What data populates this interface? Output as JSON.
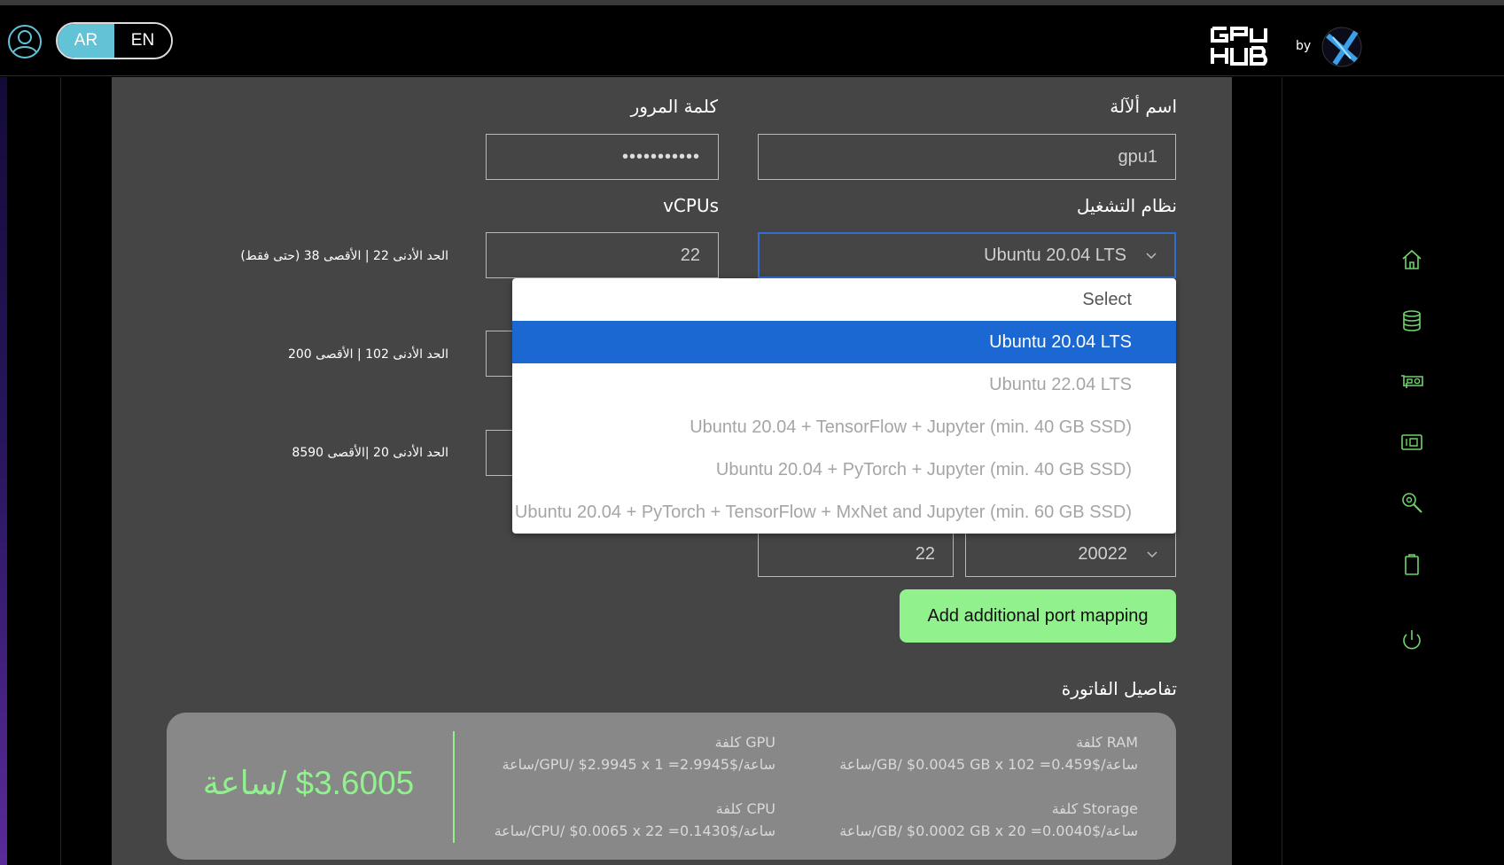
{
  "header": {
    "lang_ar": "AR",
    "lang_en": "EN"
  },
  "form": {
    "machine_name_label": "اسم ألآلة",
    "machine_name_value": "gpu1",
    "password_label": "كلمة المرور",
    "password_value": "•••••••••••",
    "os_label": "نظام التشغيل",
    "os_value": "Ubuntu 20.04 LTS",
    "vcpus_label": "vCPUs",
    "vcpus_value": "22",
    "vcpus_hint": "الحد الأدنى 22 | الأقصى 38 (حتى فقط)",
    "ram_hint": "الحد الأدنى 102 | الأقصى 200",
    "storage_hint": "الحد الأدنى 20 |الأقصى 8590",
    "port_external_value": "20022",
    "port_internal_value": "22",
    "add_port_button": "Add additional port mapping"
  },
  "os_dropdown": {
    "options": [
      "Select",
      "Ubuntu 20.04 LTS",
      "Ubuntu 22.04 LTS",
      "Ubuntu 20.04 + TensorFlow + Jupyter (min. 40 GB SSD)",
      "Ubuntu 20.04 + PyTorch + Jupyter (min. 40 GB SSD)",
      "Ubuntu 20.04 + PyTorch + TensorFlow + MxNet and Jupyter (min. 60 GB SSD)"
    ],
    "selected_index": 1
  },
  "invoice": {
    "title": "تفاصيل الفاتورة",
    "ram_title": "RAM كلفة",
    "ram_value": "ساعة/GB/ $0.0045 GB x 102 =ساعة/$0.459",
    "gpu_title": "GPU كلفة",
    "gpu_value": "ساعة/GPU/ $2.9945 x 1 =ساعة/$2.9945",
    "storage_title": "Storage كلفة",
    "storage_value": "ساعة/GB/ $0.0002 GB x 20 =ساعة/$0.0040",
    "cpu_title": "CPU كلفة",
    "cpu_value": "ساعة/CPU/ $0.0065 x 22 =ساعة/$0.1430",
    "total": "$3.6005 /ساعة"
  },
  "colors": {
    "accent_green": "#91f28d",
    "selected_blue": "#1c68d2",
    "lang_active": "#63c3d6"
  },
  "nav_icons": [
    "home-icon",
    "database-icon",
    "gpu-card-icon",
    "storage-drive-icon",
    "search-settings-icon",
    "clipboard-icon",
    "power-icon"
  ]
}
